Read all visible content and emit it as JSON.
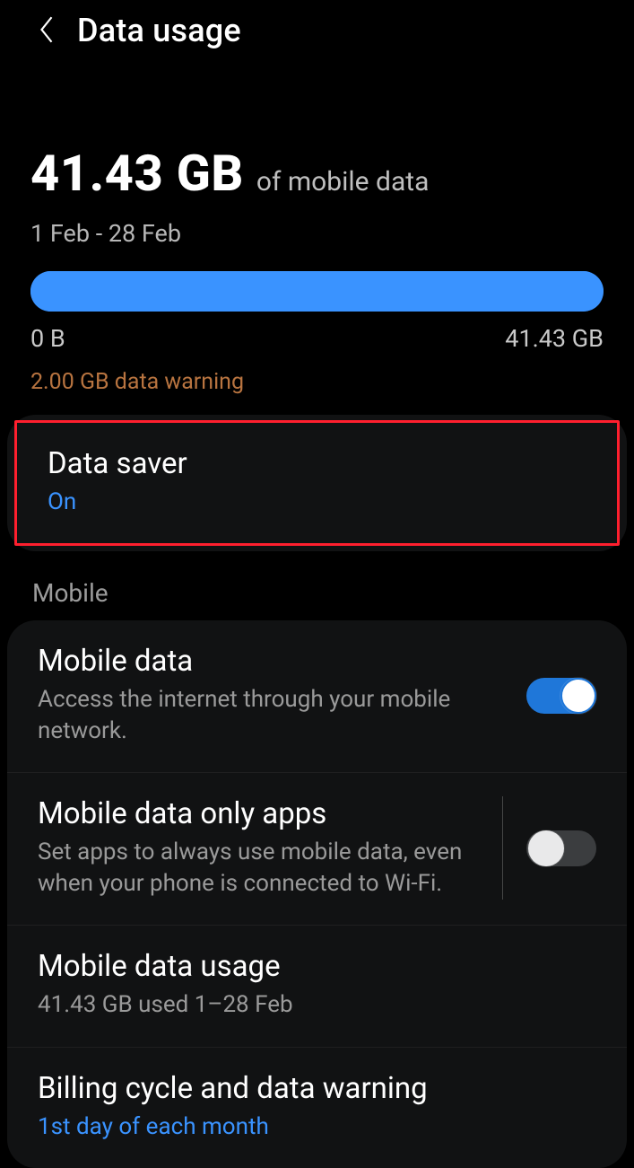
{
  "header": {
    "title": "Data usage"
  },
  "usage": {
    "amount": "41.43 GB",
    "of_label": "of mobile data",
    "range": "1 Feb - 28 Feb",
    "bar_min": "0 B",
    "bar_max": "41.43 GB",
    "percent": 100
  },
  "warning_text": "2.00 GB data warning",
  "data_saver": {
    "title": "Data saver",
    "status": "On",
    "highlighted": true
  },
  "mobile": {
    "section_label": "Mobile",
    "mobile_data": {
      "title": "Mobile data",
      "sub": "Access the internet through your mobile network.",
      "on": true
    },
    "only_apps": {
      "title": "Mobile data only apps",
      "sub": "Set apps to always use mobile data, even when your phone is connected to Wi-Fi.",
      "on": false
    },
    "usage": {
      "title": "Mobile data usage",
      "sub": "41.43 GB used 1–28 Feb"
    },
    "billing": {
      "title": "Billing cycle and data warning",
      "sub": "1st day of each month"
    }
  },
  "colors": {
    "accent": "#3a93ff",
    "warning": "#b87440",
    "highlight": "#ff1f2e"
  }
}
